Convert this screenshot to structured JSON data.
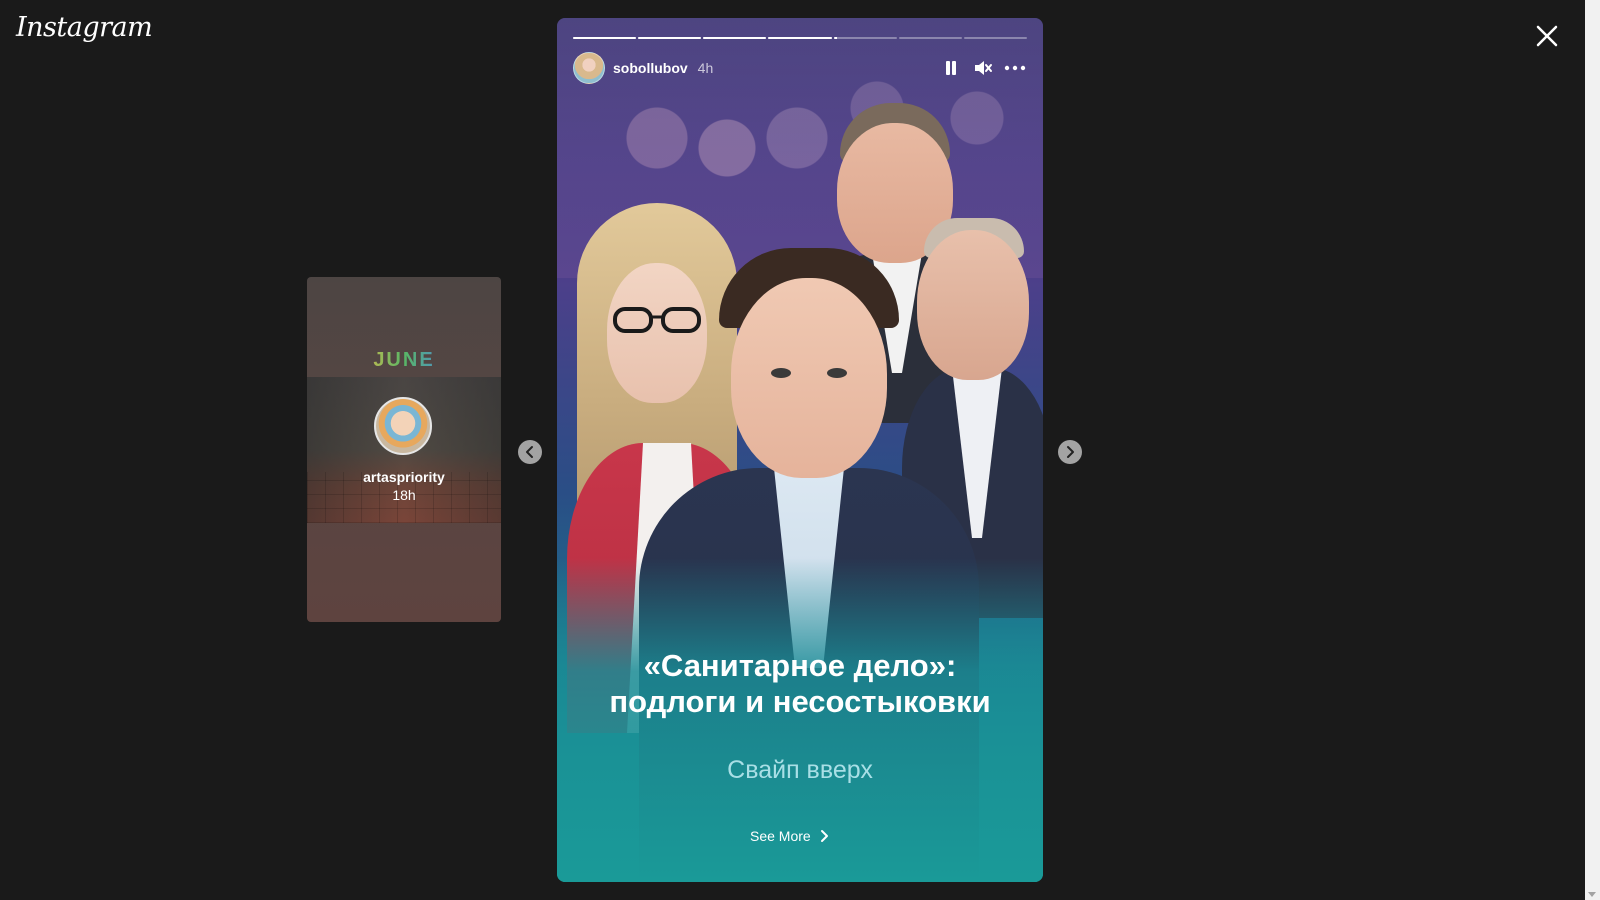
{
  "app": {
    "logo_text": "Instagram"
  },
  "icons": {
    "close": "close-icon",
    "prev": "chevron-left-icon",
    "next": "chevron-right-icon",
    "pause": "pause-icon",
    "mute": "speaker-muted-icon",
    "more": "more-horizontal-icon",
    "see_more": "chevron-right-icon"
  },
  "side_story": {
    "sticker_text": "JUNE",
    "username": "artaspriority",
    "time": "18h"
  },
  "story": {
    "username": "sobollubov",
    "time": "4h",
    "progress": {
      "segments": 7,
      "completed": 4,
      "current_progress": 0.05
    },
    "headline_line1": "«Санитарное дело»:",
    "headline_line2": "подлоги и несостыковки",
    "swipe_text": "Свайп вверх",
    "see_more_label": "See More"
  },
  "colors": {
    "background": "#1a1a1a",
    "text": "#ffffff",
    "swipe_text": "#a9dfe6"
  }
}
